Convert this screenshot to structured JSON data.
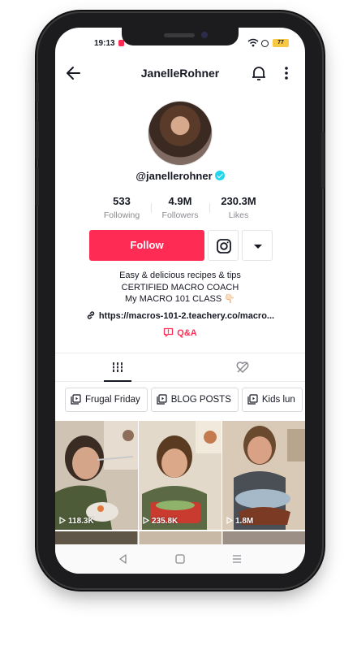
{
  "status_bar": {
    "time": "19:13",
    "battery": "77"
  },
  "header": {
    "title": "JanelleRohner"
  },
  "profile": {
    "handle": "@janellerohner",
    "stats": [
      {
        "value": "533",
        "label": "Following"
      },
      {
        "value": "4.9M",
        "label": "Followers"
      },
      {
        "value": "230.3M",
        "label": "Likes"
      }
    ],
    "follow_label": "Follow",
    "bio_lines": [
      "Easy & delicious recipes & tips",
      "CERTIFIED MACRO COACH",
      "My MACRO 101 CLASS 👇🏻"
    ],
    "link": "https://macros-101-2.teachery.co/macro...",
    "qa_label": "Q&A"
  },
  "playlists": [
    "Frugal Friday",
    "BLOG POSTS",
    "Kids lun"
  ],
  "videos": [
    {
      "views": "118.3K"
    },
    {
      "views": "235.8K"
    },
    {
      "views": "1.8M"
    }
  ],
  "colors": {
    "accent": "#fe2c55",
    "verified": "#20d5ec",
    "text": "#161823",
    "muted": "#8a8b91"
  }
}
